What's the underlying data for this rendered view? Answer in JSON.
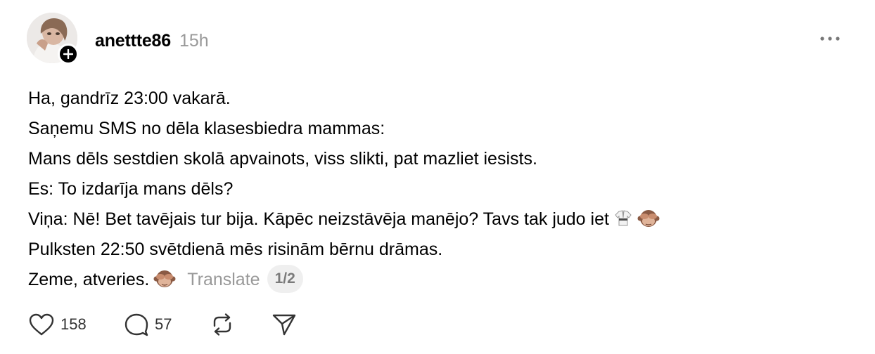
{
  "post": {
    "username": "anettte86",
    "timestamp": "15h",
    "lines": [
      "Ha, gandrīz 23:00 vakarā.",
      "Saņemu SMS no dēla klasesbiedra mammas:",
      "Mans dēls sestdien skolā apvainots, viss slikti, pat mazliet iesists.",
      "Es: To izdarīja mans dēls?",
      "Viņa: Nē! Bet tavējais tur bija. Kāpēc neizstāvēja manējo? Tavs tak judo iet",
      "Pulksten 22:50 svētdienā mēs risinām bērnu drāmas.",
      "Zeme, atveries."
    ],
    "translate_label": "Translate",
    "page_indicator": "1/2"
  },
  "actions": {
    "likes": "158",
    "replies": "57"
  },
  "icons": {
    "avatar": "profile-photo",
    "follow": "plus-icon",
    "more": "more-horizontal-icon",
    "like": "heart-icon",
    "reply": "comment-bubble-icon",
    "repost": "repost-icon",
    "share": "send-icon",
    "emoji_1": "martial-arts-uniform-emoji",
    "emoji_2": "see-no-evil-monkey-emoji"
  },
  "colors": {
    "text": "#000000",
    "muted": "#999999",
    "badge": "#000000",
    "pill_bg": "#efefef"
  }
}
